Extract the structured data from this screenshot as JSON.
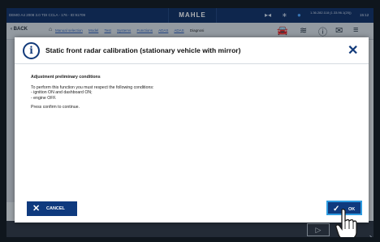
{
  "statusbar": {
    "vehicle": "DEMO A4 2008 3.0 TDI CCLA - 176 - ID:91709",
    "brand": "MAHLE",
    "info_text": "1.36.282.118 (1.33.96.1(20))",
    "time": "15:12"
  },
  "nav": {
    "back_label": "BACK",
    "crumbs": [
      "Manual selection",
      "Model",
      "Test",
      "Systems",
      "Functions",
      "ADAS",
      "ADAS"
    ],
    "diagnosis_label": "Diagnosi"
  },
  "dialog": {
    "title": "Static front radar calibration (stationary vehicle with mirror)",
    "heading": "Adjustment preliminary conditions",
    "intro": "To perform this function you must respect the following conditions:",
    "conditions": [
      "- ignition ON and dashboard ON;",
      "- engine OFF."
    ],
    "footer": "Press confirm to continue.",
    "cancel_label": "CANCEL",
    "ok_label": "OK"
  },
  "colors": {
    "header_blue": "#0c2c63",
    "button_blue": "#0f3a7e",
    "ok_highlight": "#2e9be0"
  }
}
